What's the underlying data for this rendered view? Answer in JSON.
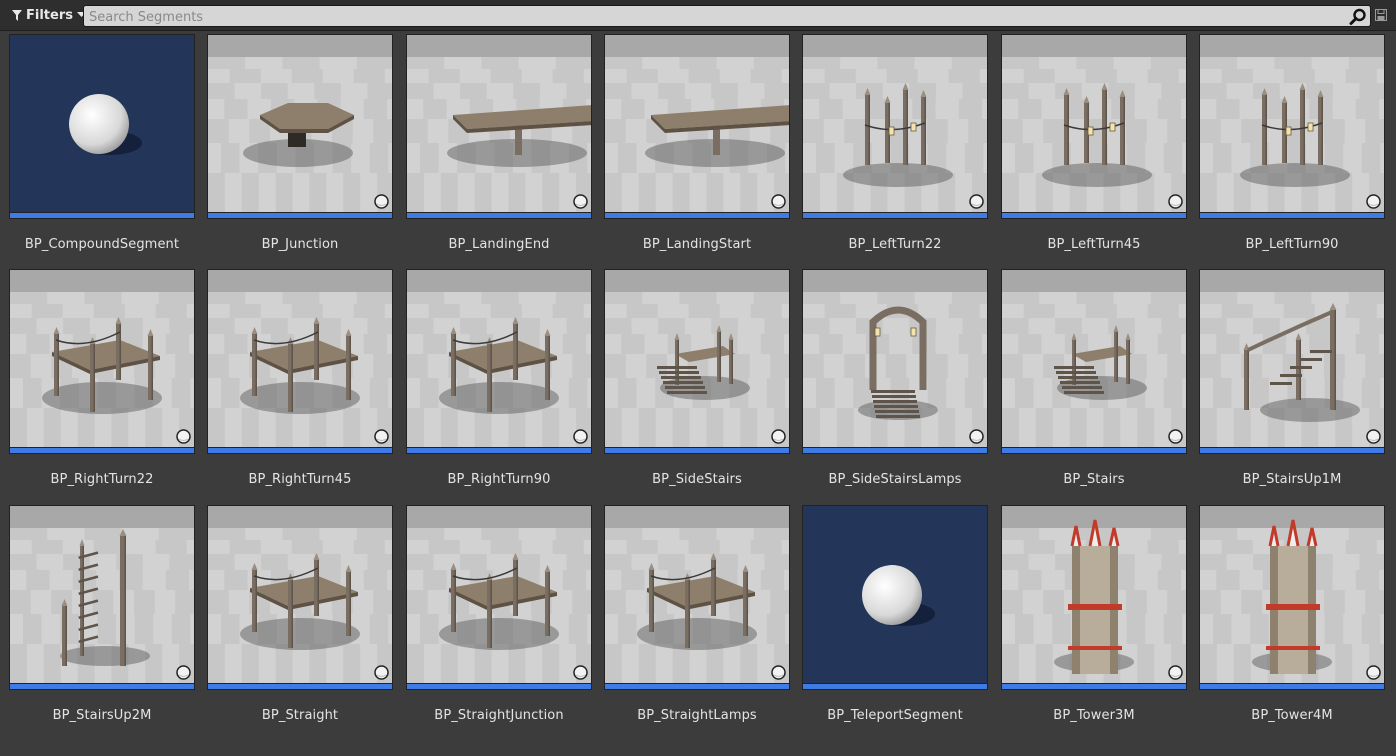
{
  "toolbar": {
    "filters_label": "Filters",
    "search_placeholder": "Search Segments"
  },
  "colors": {
    "selection_bar": "#3f7be5",
    "teleport_bg": "#233559",
    "floor_light": "#d2d2d2",
    "floor_dark": "#bdbdbd",
    "sky": "#a8a8a8",
    "wood": "#7a6e62"
  },
  "assets": [
    {
      "name": "BP_CompoundSegment",
      "thumb": "sphere",
      "badge": false
    },
    {
      "name": "BP_Junction",
      "thumb": "platform",
      "badge": true
    },
    {
      "name": "BP_LandingEnd",
      "thumb": "landing",
      "badge": true
    },
    {
      "name": "BP_LandingStart",
      "thumb": "landing",
      "badge": true
    },
    {
      "name": "BP_LeftTurn22",
      "thumb": "posts",
      "badge": true
    },
    {
      "name": "BP_LeftTurn45",
      "thumb": "posts",
      "badge": true
    },
    {
      "name": "BP_LeftTurn90",
      "thumb": "posts",
      "badge": true
    },
    {
      "name": "BP_RightTurn22",
      "thumb": "table",
      "badge": true
    },
    {
      "name": "BP_RightTurn45",
      "thumb": "table",
      "badge": true
    },
    {
      "name": "BP_RightTurn90",
      "thumb": "table",
      "badge": true
    },
    {
      "name": "BP_SideStairs",
      "thumb": "stairs",
      "badge": true
    },
    {
      "name": "BP_SideStairsLamps",
      "thumb": "arch",
      "badge": true
    },
    {
      "name": "BP_Stairs",
      "thumb": "stairs",
      "badge": true
    },
    {
      "name": "BP_StairsUp1M",
      "thumb": "tallstairs",
      "badge": true
    },
    {
      "name": "BP_StairsUp2M",
      "thumb": "ladder",
      "badge": true
    },
    {
      "name": "BP_Straight",
      "thumb": "table",
      "badge": true
    },
    {
      "name": "BP_StraightJunction",
      "thumb": "table",
      "badge": true
    },
    {
      "name": "BP_StraightLamps",
      "thumb": "table",
      "badge": true
    },
    {
      "name": "BP_TeleportSegment",
      "thumb": "sphere",
      "badge": false
    },
    {
      "name": "BP_Tower3M",
      "thumb": "tower",
      "badge": true
    },
    {
      "name": "BP_Tower4M",
      "thumb": "tower",
      "badge": true
    }
  ]
}
